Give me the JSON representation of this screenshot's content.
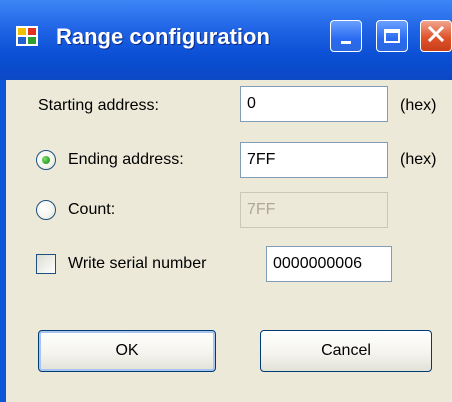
{
  "window": {
    "title": "Range configuration"
  },
  "form": {
    "starting_address": {
      "label": "Starting address:",
      "value": "0",
      "suffix": "(hex)"
    },
    "ending_address": {
      "label": "Ending address:",
      "value": "7FF",
      "suffix": "(hex)",
      "selected": true
    },
    "count": {
      "label": "Count:",
      "value": "7FF",
      "selected": false,
      "enabled": false
    },
    "serial_number": {
      "label": "Write serial number",
      "value": "0000000006",
      "checked": false
    }
  },
  "buttons": {
    "ok_label": "OK",
    "cancel_label": "Cancel"
  },
  "colors": {
    "title_bar": "#0b57d7",
    "close_button": "#e0532c",
    "dialog_background": "#ece9d8",
    "radio_selected": "#2fa221"
  },
  "icons": {
    "app": "window-app-icon",
    "minimize": "minimize-icon",
    "maximize": "maximize-icon",
    "close": "close-icon"
  }
}
